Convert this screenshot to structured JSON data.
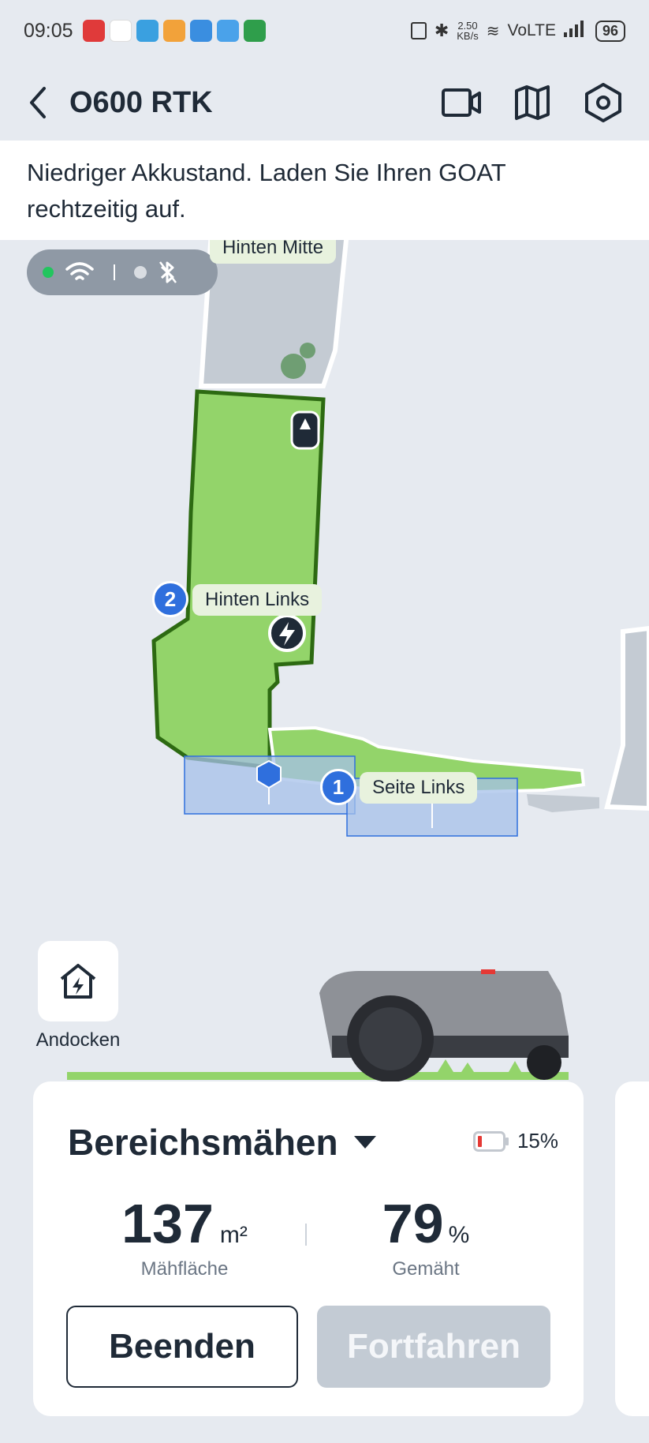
{
  "status_bar": {
    "time": "09:05",
    "net_speed_value": "2.50",
    "net_speed_unit": "KB/s",
    "network": "VoLTE",
    "battery": "96"
  },
  "header": {
    "title": "O600 RTK"
  },
  "warning": {
    "text": "Niedriger Akkustand. Laden Sie Ihren GOAT rechtzeitig auf."
  },
  "map": {
    "zones": [
      {
        "number": "",
        "label": "Hinten Mitte"
      },
      {
        "number": "2",
        "label": "Hinten Links"
      },
      {
        "number": "1",
        "label": "Seite Links"
      }
    ]
  },
  "dock": {
    "label": "Andocken"
  },
  "card": {
    "mode": "Bereichsmähen",
    "battery_percent": "15%",
    "area_value": "137",
    "area_unit": "m²",
    "area_label": "Mähfläche",
    "mowed_value": "79",
    "mowed_unit": "%",
    "mowed_label": "Gemäht",
    "end_button": "Beenden",
    "continue_button": "Fortfahren"
  },
  "colors": {
    "accent_blue": "#2f6fdd",
    "mowed_green": "#93d46a",
    "zone_border": "#2d6a12",
    "battery_low": "#e53935"
  }
}
